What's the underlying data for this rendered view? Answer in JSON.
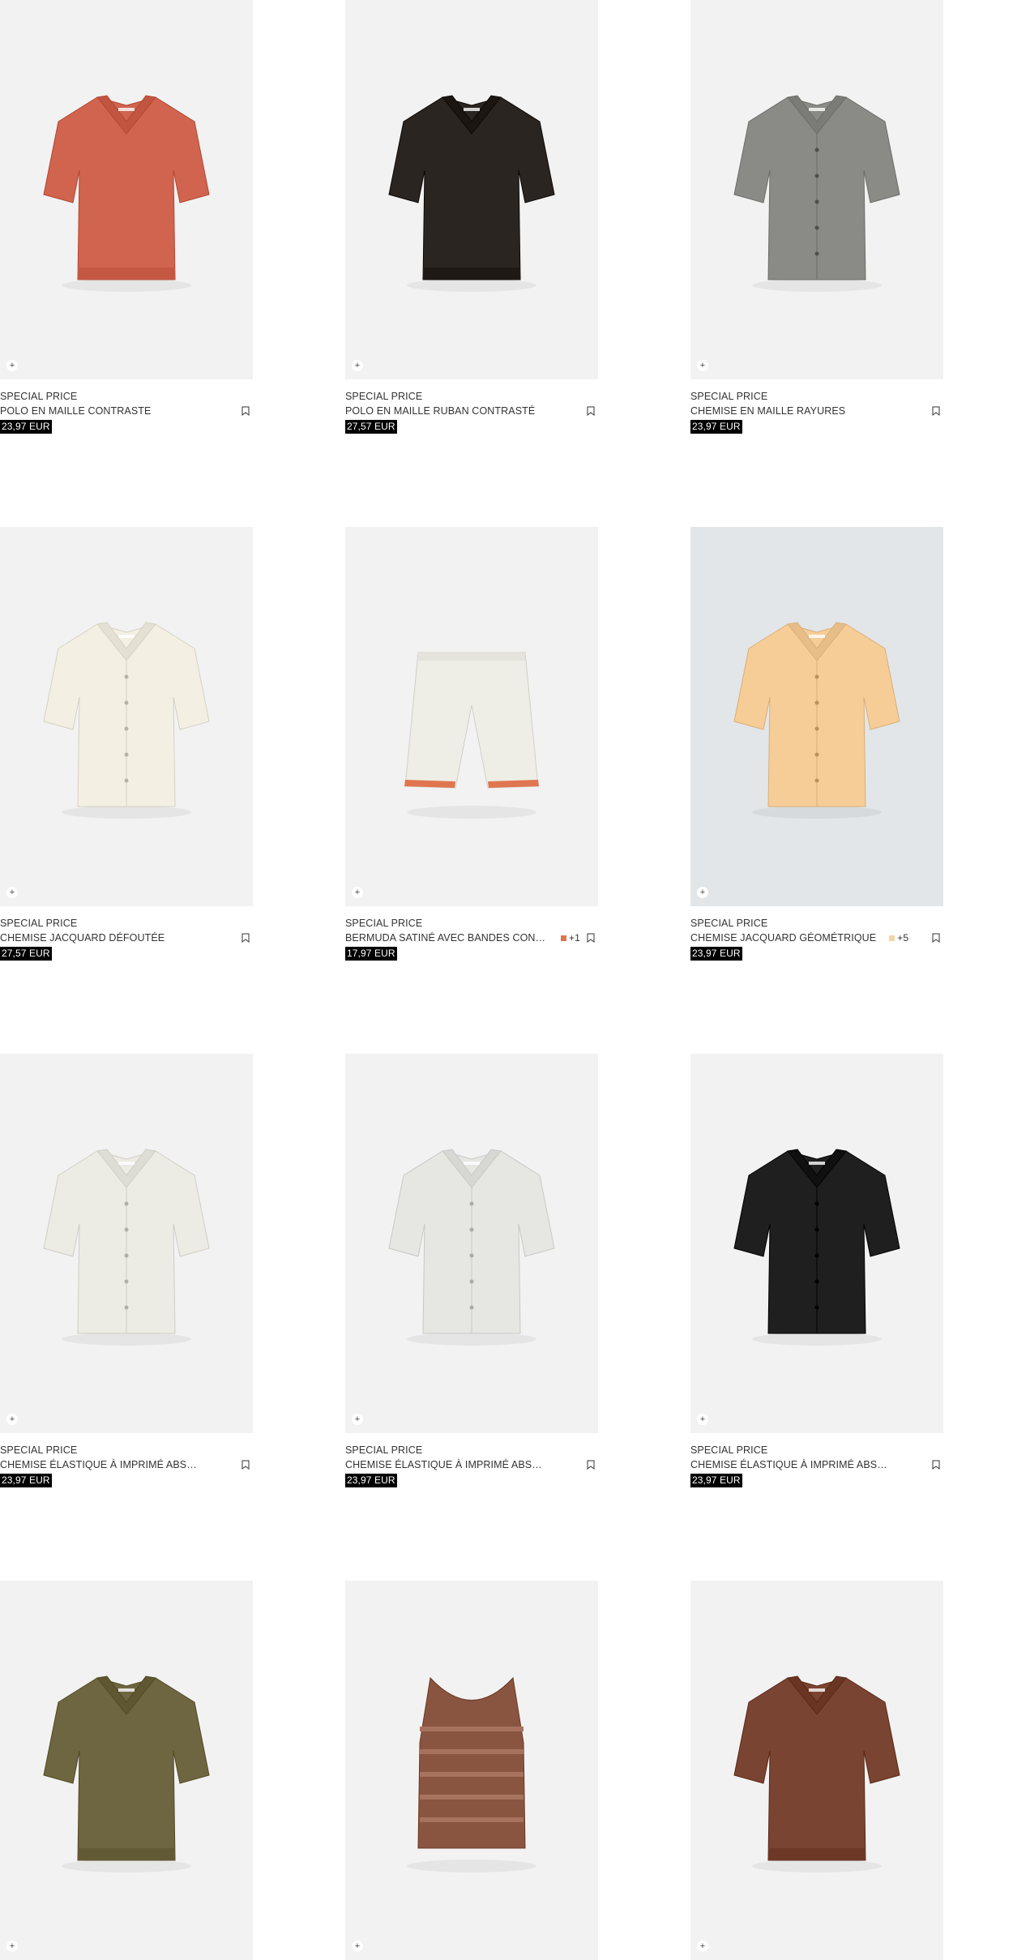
{
  "products": [
    {
      "tag": "SPECIAL PRICE",
      "name": "POLO EN MAILLE CONTRASTE",
      "price": "23,97 EUR",
      "color": "#d0644f",
      "type": "polo",
      "bg": "gray"
    },
    {
      "tag": "SPECIAL PRICE",
      "name": "POLO EN MAILLE RUBAN CONTRASTÉ",
      "price": "27,57 EUR",
      "color": "#2b2522",
      "type": "polo",
      "bg": "gray"
    },
    {
      "tag": "SPECIAL PRICE",
      "name": "CHEMISE EN MAILLE RAYURES",
      "price": "23,97 EUR",
      "color": "#8a8a86",
      "type": "shirt",
      "bg": "gray"
    },
    {
      "tag": "SPECIAL PRICE",
      "name": "CHEMISE JACQUARD DÉFOUTÉE",
      "price": "27,57 EUR",
      "color": "#f3efe2",
      "type": "shirt",
      "bg": "gray"
    },
    {
      "tag": "SPECIAL PRICE",
      "name": "BERMUDA SATINÉ AVEC BANDES CONT...",
      "price": "17,97 EUR",
      "color": "#eeeee6",
      "type": "shorts",
      "bg": "gray",
      "swatch_color": "#e07650",
      "swatch_extra": "+1"
    },
    {
      "tag": "SPECIAL PRICE",
      "name": "CHEMISE JACQUARD GÉOMÉTRIQUE",
      "price": "23,97 EUR",
      "color": "#f6cd97",
      "type": "shirt",
      "bg": "blue",
      "swatch_color": "#f0d6a6",
      "swatch_extra": "+5"
    },
    {
      "tag": "SPECIAL PRICE",
      "name": "CHEMISE ÉLASTIQUE À IMPRIMÉ ABSTRAIT",
      "price": "23,97 EUR",
      "color": "#ecebe4",
      "type": "shirt",
      "bg": "gray"
    },
    {
      "tag": "SPECIAL PRICE",
      "name": "CHEMISE ÉLASTIQUE À IMPRIMÉ ABSTRAIT",
      "price": "23,97 EUR",
      "color": "#e6e6e3",
      "type": "shirt",
      "bg": "gray"
    },
    {
      "tag": "SPECIAL PRICE",
      "name": "CHEMISE ÉLASTIQUE À IMPRIMÉ ABSTRAIT",
      "price": "23,97 EUR",
      "color": "#1f1f1f",
      "type": "shirt",
      "bg": "gray"
    },
    {
      "color": "#6e6640",
      "type": "polo",
      "bg": "gray"
    },
    {
      "color": "#8a5540",
      "type": "tank",
      "bg": "gray"
    },
    {
      "color": "#7a4432",
      "type": "polo",
      "bg": "gray"
    }
  ],
  "icons": {
    "plus": "+",
    "bookmark": "bookmark-icon"
  }
}
